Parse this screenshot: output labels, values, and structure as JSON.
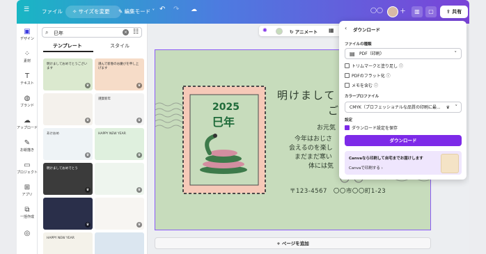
{
  "topbar": {
    "file_label": "ファイル",
    "resize_label": "サイズを変更",
    "edit_mode_label": "編集モード",
    "share_label": "共有"
  },
  "sidebar": {
    "items": [
      {
        "label": "デザイン",
        "icon": "design-icon"
      },
      {
        "label": "素材",
        "icon": "elements-icon"
      },
      {
        "label": "テキスト",
        "icon": "text-icon"
      },
      {
        "label": "ブランド",
        "icon": "brand-icon"
      },
      {
        "label": "アップロード",
        "icon": "upload-icon"
      },
      {
        "label": "お絵描き",
        "icon": "draw-icon"
      },
      {
        "label": "プロジェクト",
        "icon": "projects-icon"
      },
      {
        "label": "アプリ",
        "icon": "apps-icon"
      },
      {
        "label": "一括作成",
        "icon": "bulk-create-icon"
      }
    ]
  },
  "panel": {
    "search_value": "巳年",
    "tabs": [
      {
        "label": "テンプレート"
      },
      {
        "label": "スタイル"
      }
    ],
    "thumbs": [
      {
        "text": "明けましておめでとうございます",
        "bg": "#dbe9cf"
      },
      {
        "text": "謹んで新春のお慶びを申し上げます",
        "bg": "#f6dcc8"
      },
      {
        "text": "",
        "bg": "#f4f1ec"
      },
      {
        "text": "謹賀新年",
        "bg": "#f3f3f3"
      },
      {
        "text": "あけおめ",
        "bg": "#eef3f6"
      },
      {
        "text": "HAPPY NEW YEAR",
        "bg": "#dff0de"
      },
      {
        "text": "明けましておめでとう",
        "bg": "#3b3b3b"
      },
      {
        "text": "",
        "bg": "#eef5ee"
      },
      {
        "text": "",
        "bg": "#2a2f4a"
      },
      {
        "text": "",
        "bg": "#f7f5f2"
      },
      {
        "text": "HAPPY NEW YEAR",
        "bg": "#f4f2ea"
      },
      {
        "text": "",
        "bg": "#dbe6f0"
      }
    ]
  },
  "card": {
    "stamp_year": "2025",
    "stamp_kanji": "巳年",
    "greeting_line1": "明けまして",
    "greeting_line2": "ござい",
    "body": [
      "お元気",
      "今年はおじさ",
      "会えるのを楽し",
      "まだまだ寒い",
      "体には気"
    ],
    "address": "〒123-4567　〇〇市〇〇町1-23",
    "bg": "#c7dcbc",
    "stamp_bg": "#f6c9b8",
    "accent": "#1f6b3a"
  },
  "canvas_toolbar": {
    "animate_label": "アニメート"
  },
  "add_page_label": "+ ページを追加",
  "download": {
    "title": "ダウンロード",
    "file_type_label": "ファイルの種類",
    "file_type_value": "PDF（印刷）",
    "options": [
      {
        "label": "トリムマークと塗り足し",
        "checked": false
      },
      {
        "label": "PDFのフラット化",
        "checked": false
      },
      {
        "label": "メモを含む",
        "checked": false
      }
    ],
    "color_profile_label": "カラープロファイル",
    "color_profile_value": "CMYK（プロフェッショナルな品質の印刷に最...",
    "settings_label": "設定",
    "save_settings_label": "ダウンロード設定を保存",
    "download_button": "ダウンロード",
    "promo_title": "Canvaなら印刷して自宅までお届けします",
    "promo_link": "Canvaで印刷する",
    "accent": "#7d2ae8"
  }
}
